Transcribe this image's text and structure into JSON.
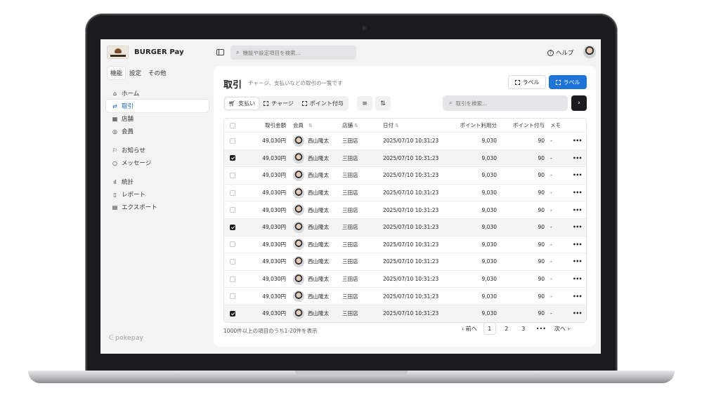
{
  "app": {
    "brand_name": "BURGER Pay"
  },
  "sidebar": {
    "tabs": [
      {
        "label": "機能",
        "active": true
      },
      {
        "label": "設定",
        "active": false
      },
      {
        "label": "その他",
        "active": false
      }
    ],
    "items": [
      {
        "label": "ホーム",
        "icon": "home-icon",
        "active": false
      },
      {
        "label": "取引",
        "icon": "transfer-icon",
        "active": true
      },
      {
        "label": "店舗",
        "icon": "store-icon",
        "active": false
      },
      {
        "label": "会員",
        "icon": "member-icon",
        "active": false
      },
      {
        "label": "お知らせ",
        "icon": "flag-icon",
        "active": false
      },
      {
        "label": "メッセージ",
        "icon": "message-icon",
        "active": false
      },
      {
        "label": "統計",
        "icon": "chart-icon",
        "active": false
      },
      {
        "label": "レポート",
        "icon": "report-icon",
        "active": false
      },
      {
        "label": "エクスポート",
        "icon": "export-icon",
        "active": false
      }
    ],
    "footer_logo": "pokepay"
  },
  "topbar": {
    "search_placeholder": "機能や設定項目を検索...",
    "help_label": "ヘルプ"
  },
  "main": {
    "title": "取引",
    "subtitle": "チャージ、支払いなどの取引の一覧です",
    "label_button_outline": "ラベル",
    "label_button_primary": "ラベル",
    "filter_tabs": [
      {
        "label": "支払い",
        "icon": "cart-icon",
        "active": true
      },
      {
        "label": "チャージ",
        "icon": "dashed-square-icon",
        "active": false
      },
      {
        "label": "ポイント付与",
        "icon": "dashed-square-icon",
        "active": false
      }
    ],
    "table_search_placeholder": "取引を検索..."
  },
  "table": {
    "columns": [
      "取引金額",
      "会員",
      "店舗",
      "日付",
      "ポイント利用分",
      "ポイント付与",
      "メモ"
    ],
    "rows": [
      {
        "selected": false,
        "amount": "49,030円",
        "member": "西山隆太",
        "store": "三田店",
        "date": "2025/07/10 10:31:23",
        "points_used": "9,030",
        "points_awarded": "90",
        "memo": "-"
      },
      {
        "selected": true,
        "amount": "49,030円",
        "member": "西山隆太",
        "store": "三田店",
        "date": "2025/07/10 10:31:23",
        "points_used": "9,030",
        "points_awarded": "90",
        "memo": "-"
      },
      {
        "selected": false,
        "amount": "49,030円",
        "member": "西山隆太",
        "store": "三田店",
        "date": "2025/07/10 10:31:23",
        "points_used": "9,030",
        "points_awarded": "90",
        "memo": "-"
      },
      {
        "selected": false,
        "amount": "49,030円",
        "member": "西山隆太",
        "store": "三田店",
        "date": "2025/07/10 10:31:23",
        "points_used": "9,030",
        "points_awarded": "90",
        "memo": "-"
      },
      {
        "selected": false,
        "amount": "49,030円",
        "member": "西山隆太",
        "store": "三田店",
        "date": "2025/07/10 10:31:23",
        "points_used": "9,030",
        "points_awarded": "90",
        "memo": "-"
      },
      {
        "selected": true,
        "amount": "49,030円",
        "member": "西山隆太",
        "store": "三田店",
        "date": "2025/07/10 10:31:23",
        "points_used": "9,030",
        "points_awarded": "90",
        "memo": "-"
      },
      {
        "selected": false,
        "amount": "49,030円",
        "member": "西山隆太",
        "store": "三田店",
        "date": "2025/07/10 10:31:23",
        "points_used": "9,030",
        "points_awarded": "90",
        "memo": "-"
      },
      {
        "selected": false,
        "amount": "49,030円",
        "member": "西山隆太",
        "store": "三田店",
        "date": "2025/07/10 10:31:23",
        "points_used": "9,030",
        "points_awarded": "90",
        "memo": "-"
      },
      {
        "selected": false,
        "amount": "49,030円",
        "member": "西山隆太",
        "store": "三田店",
        "date": "2025/07/10 10:31:23",
        "points_used": "9,030",
        "points_awarded": "90",
        "memo": "-"
      },
      {
        "selected": false,
        "amount": "49,030円",
        "member": "西山隆太",
        "store": "三田店",
        "date": "2025/07/10 10:31:23",
        "points_used": "9,030",
        "points_awarded": "90",
        "memo": "-"
      },
      {
        "selected": true,
        "amount": "49,030円",
        "member": "西山隆太",
        "store": "三田店",
        "date": "2025/07/10 10:31:23",
        "points_used": "9,030",
        "points_awarded": "90",
        "memo": "-"
      }
    ]
  },
  "footer": {
    "count_text": "1000件以上の項目のうち1-20件を表示",
    "prev_label": "前へ",
    "next_label": "次へ",
    "pages": [
      "1",
      "2",
      "3"
    ],
    "current_page": "1",
    "ellipsis": "•••"
  },
  "colors": {
    "accent": "#1e74d6",
    "dark_button": "#1d1d1f",
    "background": "#f3f3f4"
  }
}
